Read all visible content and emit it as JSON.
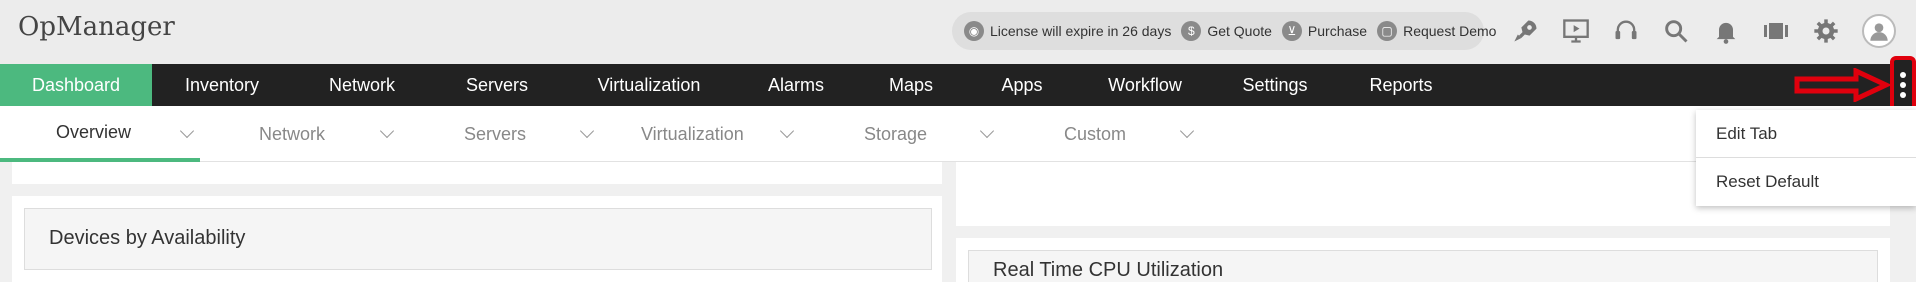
{
  "header": {
    "logo": "OpManager",
    "license": "License will expire in 26 days",
    "get_quote": "Get Quote",
    "purchase": "Purchase",
    "request_demo": "Request Demo",
    "icons": [
      "rocket-icon",
      "presentation-icon",
      "headset-icon",
      "search-icon",
      "bell-icon",
      "server-icon",
      "gear-icon",
      "user-icon"
    ]
  },
  "nav": {
    "items": [
      "Dashboard",
      "Inventory",
      "Network",
      "Servers",
      "Virtualization",
      "Alarms",
      "Maps",
      "Apps",
      "Workflow",
      "Settings",
      "Reports"
    ],
    "active": "Dashboard",
    "accent_color": "#4cb97f"
  },
  "subnav": {
    "tabs": [
      "Overview",
      "Network",
      "Servers",
      "Virtualization",
      "Storage",
      "Custom"
    ],
    "active": "Overview"
  },
  "menu": {
    "items": [
      "Edit Tab",
      "Reset Default"
    ]
  },
  "widgets": {
    "left_title": "Devices by Availability",
    "right_title": "Real Time CPU Utilization"
  }
}
